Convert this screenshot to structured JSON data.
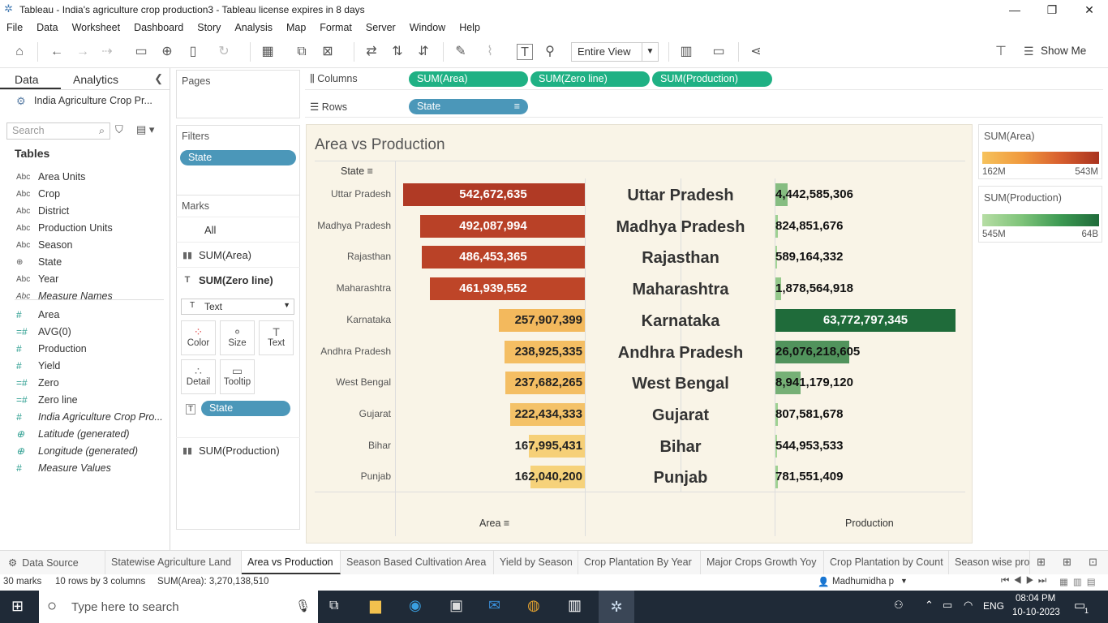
{
  "window": {
    "title": "Tableau - India's agriculture crop production3 - Tableau license expires in 8 days",
    "minimize": "—",
    "restore": "❐",
    "close": "✕"
  },
  "menu": [
    "File",
    "Data",
    "Worksheet",
    "Dashboard",
    "Story",
    "Analysis",
    "Map",
    "Format",
    "Server",
    "Window",
    "Help"
  ],
  "toolbar": {
    "fit": "Entire View",
    "show_me": "Show Me"
  },
  "data_pane": {
    "tab_data": "Data",
    "tab_analytics": "Analytics",
    "datasource": "India Agriculture Crop Pr...",
    "search_placeholder": "Search",
    "tables_heading": "Tables",
    "dimensions": [
      {
        "type": "Abc",
        "name": "Area Units"
      },
      {
        "type": "Abc",
        "name": "Crop"
      },
      {
        "type": "Abc",
        "name": "District"
      },
      {
        "type": "Abc",
        "name": "Production Units"
      },
      {
        "type": "Abc",
        "name": "Season"
      },
      {
        "type": "⊕",
        "name": "State"
      },
      {
        "type": "Abc",
        "name": "Year"
      },
      {
        "type": "Abc",
        "name": "Measure Names"
      }
    ],
    "measures": [
      {
        "type": "#",
        "name": "Area"
      },
      {
        "type": "=#",
        "name": "AVG(0)"
      },
      {
        "type": "#",
        "name": "Production"
      },
      {
        "type": "#",
        "name": "Yield"
      },
      {
        "type": "=#",
        "name": "Zero"
      },
      {
        "type": "=#",
        "name": "Zero line"
      },
      {
        "type": "#",
        "name": "India Agriculture Crop Pro..."
      },
      {
        "type": "⊕",
        "name": "Latitude (generated)"
      },
      {
        "type": "⊕",
        "name": "Longitude (generated)"
      },
      {
        "type": "#",
        "name": "Measure Values"
      }
    ]
  },
  "shelves": {
    "pages": "Pages",
    "filters": "Filters",
    "filter_pill": "State",
    "marks": "Marks",
    "marks_all": "All",
    "marks_area": "SUM(Area)",
    "marks_zero": "SUM(Zero line)",
    "mark_type": "Text",
    "color": "Color",
    "size": "Size",
    "text": "Text",
    "detail": "Detail",
    "tooltip": "Tooltip",
    "text_pill": "State",
    "marks_production": "SUM(Production)",
    "columns_label": "Columns",
    "rows_label": "Rows",
    "columns": [
      "SUM(Area)",
      "SUM(Zero line)",
      "SUM(Production)"
    ],
    "rows": [
      "State"
    ]
  },
  "viz": {
    "title": "Area vs Production",
    "row_header": "State",
    "x_label_area": "Area",
    "x_label_production": "Production"
  },
  "chart_data": {
    "type": "bar",
    "title": "Area vs Production",
    "categories": [
      "Uttar Pradesh",
      "Madhya Pradesh",
      "Rajasthan",
      "Maharashtra",
      "Karnataka",
      "Andhra Pradesh",
      "West Bengal",
      "Gujarat",
      "Bihar",
      "Punjab"
    ],
    "series": [
      {
        "name": "Area",
        "values": [
          542672635,
          492087994,
          486453365,
          461939552,
          257907399,
          238925335,
          237682265,
          222434333,
          167995431,
          162040200
        ],
        "labels": [
          "542,672,635",
          "492,087,994",
          "486,453,365",
          "461,939,552",
          "257,907,399",
          "238,925,335",
          "237,682,265",
          "222,434,333",
          "167,995,431",
          "162,040,200"
        ]
      },
      {
        "name": "Production",
        "values": [
          4442585306,
          824851676,
          589164332,
          1878564918,
          63772797345,
          26076218605,
          8941179120,
          807581678,
          544953533,
          781551409
        ],
        "labels": [
          "4,442,585,306",
          "824,851,676",
          "589,164,332",
          "1,878,564,918",
          "63,772,797,345",
          "26,076,218,605",
          "8,941,179,120",
          "807,581,678",
          "544,953,533",
          "781,551,409"
        ]
      }
    ],
    "xlabel_left": "Area",
    "xlabel_right": "Production",
    "ylabel": "State",
    "colors": {
      "area_low": "#f6d27a",
      "area_high": "#b03a25",
      "prod_low": "#a8d898",
      "prod_high": "#1f6b3a"
    }
  },
  "legends": {
    "area": {
      "title": "SUM(Area)",
      "min": "162M",
      "max": "543M"
    },
    "production": {
      "title": "SUM(Production)",
      "min": "545M",
      "max": "64B"
    }
  },
  "sheet_tabs": [
    "Data Source",
    "Statewise Agriculture Land",
    "Area vs Production",
    "Season Based Cultivation Area",
    "Yield by Season",
    "Crop Plantation By Year",
    "Major Crops Growth Yoy",
    "Crop Plantation by Count",
    "Season wise pro"
  ],
  "active_tab": "Area vs Production",
  "status": {
    "marks": "30 marks",
    "rows_cols": "10 rows by 3 columns",
    "sum": "SUM(Area): 3,270,138,510",
    "user": "Madhumidha p"
  },
  "taskbar": {
    "search_placeholder": "Type here to search",
    "lang": "ENG",
    "time": "08:04 PM",
    "date": "10-10-2023",
    "notif": "1"
  }
}
